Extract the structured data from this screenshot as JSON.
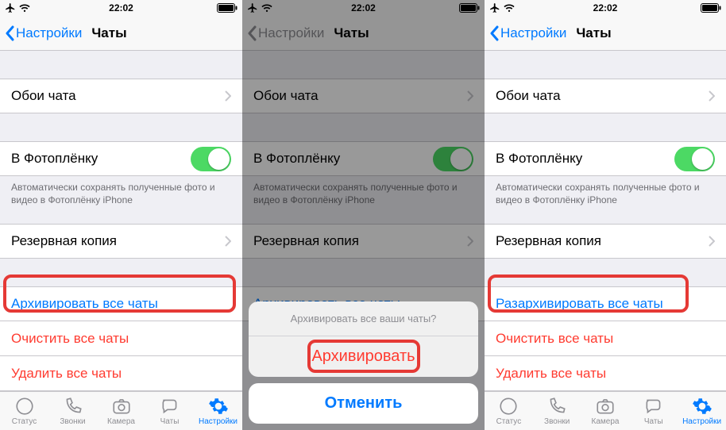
{
  "statusbar": {
    "time": "22:02"
  },
  "navbar": {
    "back": "Настройки",
    "title": "Чаты"
  },
  "cells": {
    "wallpaper": "Обои чата",
    "cameraRoll": "В Фотоплёнку",
    "cameraRollNote": "Автоматически сохранять полученные фото и видео в Фотоплёнку iPhone",
    "backup": "Резервная копия",
    "archiveAll": "Архивировать все чаты",
    "unarchiveAll": "Разархивировать все чаты",
    "clearAll": "Очистить все чаты",
    "deleteAll": "Удалить все чаты"
  },
  "sheet": {
    "title": "Архивировать все ваши чаты?",
    "archive": "Архивировать",
    "cancel": "Отменить"
  },
  "tabs": {
    "status": "Статус",
    "calls": "Звонки",
    "camera": "Камера",
    "chats": "Чаты",
    "settings": "Настройки"
  }
}
